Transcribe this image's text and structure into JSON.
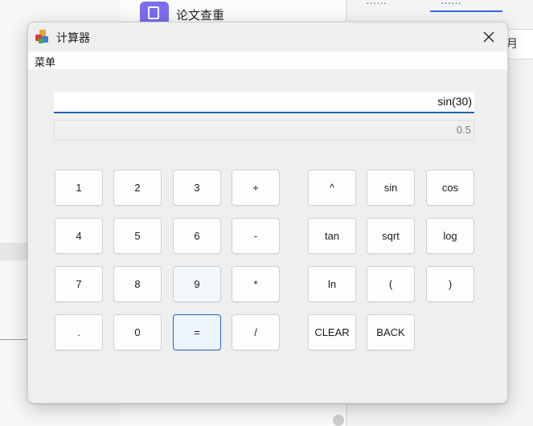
{
  "background": {
    "doc_label": "论文查重",
    "tab_left": "……",
    "tab_active": "……",
    "month_text": "月"
  },
  "window": {
    "title": "计算器",
    "app_icon": "calculator-app-icon",
    "close_icon": "close-icon"
  },
  "menu": {
    "label": "菜单"
  },
  "display": {
    "expression": "sin(30)",
    "result": "0.5"
  },
  "keys": {
    "k1": "1",
    "k2": "2",
    "k3": "3",
    "plus": "+",
    "k4": "4",
    "k5": "5",
    "k6": "6",
    "minus": "-",
    "k7": "7",
    "k8": "8",
    "k9": "9",
    "times": "*",
    "dot": ".",
    "k0": "0",
    "equals": "=",
    "divide": "/",
    "power": "^",
    "sin": "sin",
    "cos": "cos",
    "tan": "tan",
    "sqrt": "sqrt",
    "log": "log",
    "ln": "ln",
    "lparen": "(",
    "rparen": ")",
    "clear": "CLEAR",
    "back": "BACK"
  },
  "colors": {
    "accent": "#2166b0",
    "focus_border": "#1a6ac0"
  }
}
